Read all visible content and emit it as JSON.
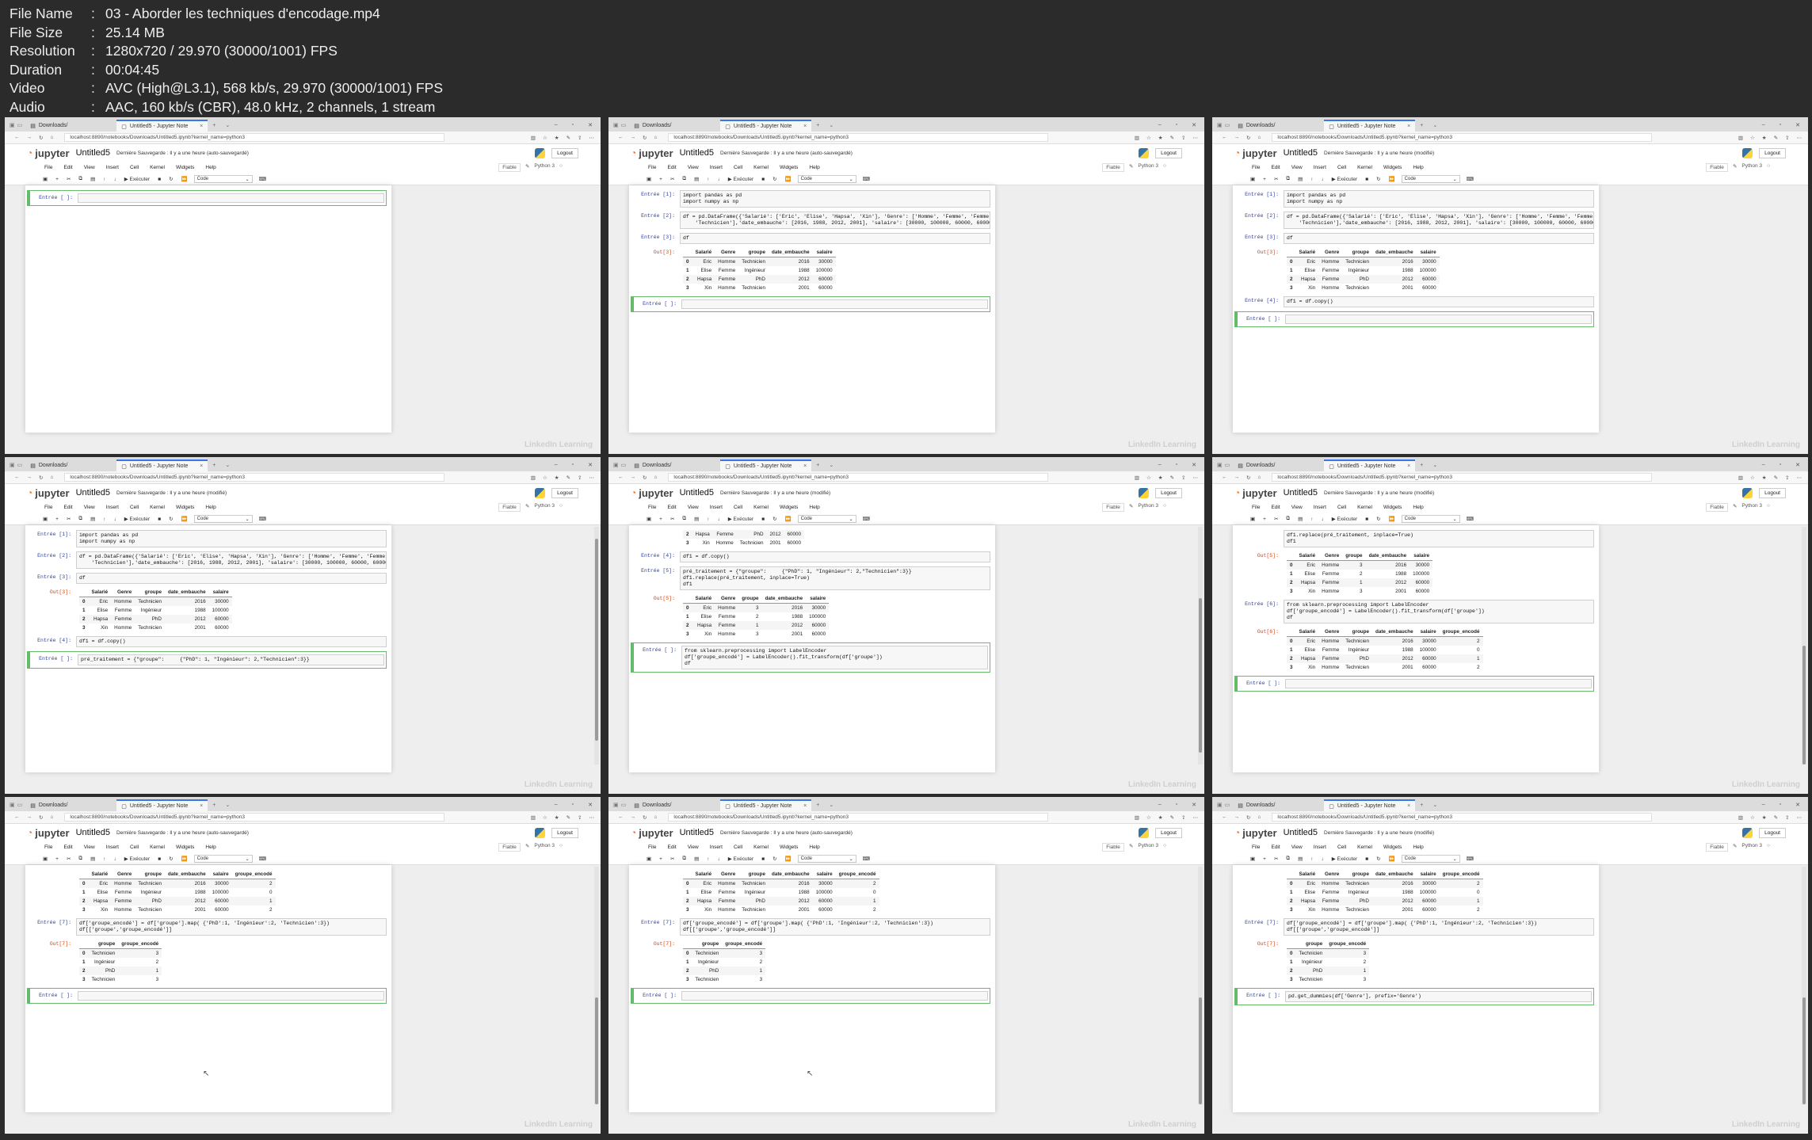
{
  "meta": [
    {
      "key": "File Name",
      "sep": ":",
      "value": "03 - Aborder les techniques d'encodage.mp4"
    },
    {
      "key": "File Size",
      "sep": ":",
      "value": "25.14 MB"
    },
    {
      "key": "Resolution",
      "sep": ":",
      "value": "1280x720 / 29.970 (30000/1001) FPS"
    },
    {
      "key": "Duration",
      "sep": ":",
      "value": "00:04:45"
    },
    {
      "key": "Video",
      "sep": ":",
      "value": "AVC (High@L3.1), 568 kb/s, 29.970 (30000/1001) FPS"
    },
    {
      "key": "Audio",
      "sep": ":",
      "value": "AAC, 160 kb/s (CBR), 48.0 kHz, 2 channels, 1 stream"
    }
  ],
  "browser": {
    "tab_downloads": "Downloads/",
    "tab_jupyter": "Untitled5 - Jupyter Note",
    "tab_close": "×",
    "tab_new": "+",
    "url": "localhost:8890/notebooks/Downloads/Untitled5.ipynb?kernel_name=python3"
  },
  "jupyter": {
    "logo": "jupyter",
    "title": "Untitled5",
    "save_auto": "Dernière Sauvegarde : Il y a une heure  (auto-sauvegardé)",
    "save_mod": "Dernière Sauvegarde : Il y a une heure  (modifié)",
    "logout": "Logout",
    "menus": [
      "File",
      "Edit",
      "View",
      "Insert",
      "Cell",
      "Kernel",
      "Widgets",
      "Help"
    ],
    "trusted": "Fiable",
    "kernel": "Python 3",
    "run": "Exécuter",
    "celltype": "Code"
  },
  "prompts": {
    "in_empty": "Entrée [ ]:",
    "in1": "Entrée [1]:",
    "in2": "Entrée [2]:",
    "in3": "Entrée [3]:",
    "in4": "Entrée [4]:",
    "in5": "Entrée [5]:",
    "in6": "Entrée [6]:",
    "in7": "Entrée [7]:",
    "out3": "Out[3]:",
    "out5": "Out[5]:",
    "out6": "Out[6]:",
    "out7": "Out[7]:"
  },
  "code": {
    "imports": "import pandas as pd\nimport numpy as np",
    "df_create": "df = pd.DataFrame({'Salarié': ['Eric', 'Elise', 'Hapsa', 'Xin'], 'Genre': ['Homme', 'Femme', 'Femme', 'Homme'], 'groupe': ['Tech\n    'Technicien'],'date_embauche': [2016, 1988, 2012, 2001], 'salaire': [30000, 100000, 60000, 60000]})",
    "df": "df",
    "df1_copy": "df1 = df.copy()",
    "pre_partial": "pré_traitement = {\"groupe\":     {\"PhD\": 1, \"Ingénieur\": 2,\"Technicien\":3}}",
    "pre_full": "pré_traitement = {\"groupe\":     {\"PhD\": 1, \"Ingénieur\": 2,\"Technicien\":3}}\ndf1.replace(pré_traitement, inplace=True)\ndf1",
    "pre_tail": "df1.replace(pré_traitement, inplace=True)\ndf1",
    "label_enc": "from sklearn.preprocessing import LabelEncoder\ndf['groupe_encodé'] = LabelEncoder().fit_transform(df['groupe'])\ndf",
    "map_code": "df['groupe_encodé'] = df['groupe'].map( {'PhD':1, 'Ingénieur':2, 'Technicien':3})\ndf[['groupe','groupe_encodé']]",
    "dummies": "pd.get_dummies(df['Genre'], prefix='Genre')"
  },
  "tables": {
    "cols5": [
      "",
      "Salarié",
      "Genre",
      "groupe",
      "date_embauche",
      "salaire"
    ],
    "cols6": [
      "",
      "Salarié",
      "Genre",
      "groupe",
      "date_embauche",
      "salaire",
      "groupe_encodé"
    ],
    "cols2": [
      "",
      "groupe",
      "groupe_encodé"
    ],
    "df": [
      [
        "0",
        "Eric",
        "Homme",
        "Technicien",
        "2016",
        "30000"
      ],
      [
        "1",
        "Elise",
        "Femme",
        "Ingénieur",
        "1988",
        "100000"
      ],
      [
        "2",
        "Hapsa",
        "Femme",
        "PhD",
        "2012",
        "60000"
      ],
      [
        "3",
        "Xin",
        "Homme",
        "Technicien",
        "2001",
        "60000"
      ]
    ],
    "df1": [
      [
        "0",
        "Eric",
        "Homme",
        "3",
        "2016",
        "30000"
      ],
      [
        "1",
        "Elise",
        "Femme",
        "2",
        "1988",
        "100000"
      ],
      [
        "2",
        "Hapsa",
        "Femme",
        "1",
        "2012",
        "60000"
      ],
      [
        "3",
        "Xin",
        "Homme",
        "3",
        "2001",
        "60000"
      ]
    ],
    "df_le": [
      [
        "0",
        "Eric",
        "Homme",
        "Technicien",
        "2016",
        "30000",
        "2"
      ],
      [
        "1",
        "Elise",
        "Femme",
        "Ingénieur",
        "1988",
        "100000",
        "0"
      ],
      [
        "2",
        "Hapsa",
        "Femme",
        "PhD",
        "2012",
        "60000",
        "1"
      ],
      [
        "3",
        "Xin",
        "Homme",
        "Technicien",
        "2001",
        "60000",
        "2"
      ]
    ],
    "map_out": [
      [
        "0",
        "Technicien",
        "3"
      ],
      [
        "1",
        "Ingénieur",
        "2"
      ],
      [
        "2",
        "PhD",
        "1"
      ],
      [
        "3",
        "Technicien",
        "3"
      ]
    ]
  },
  "tiles": [
    {
      "save": "save_auto",
      "scroll": {
        "top": 0.0,
        "size": 0.0
      },
      "cells": [
        {
          "t": "in",
          "p": "in_empty",
          "c": "",
          "edit": true
        }
      ]
    },
    {
      "save": "save_auto",
      "scroll": {
        "top": 0.0,
        "size": 0.0
      },
      "cells": [
        {
          "t": "in",
          "p": "in1",
          "c": "imports"
        },
        {
          "t": "in",
          "p": "in2",
          "c": "df_create"
        },
        {
          "t": "in",
          "p": "in3",
          "c": "df"
        },
        {
          "t": "out",
          "p": "out3",
          "table": "df",
          "cols": "cols5"
        },
        {
          "t": "in",
          "p": "in_empty",
          "c": "",
          "edit": true
        }
      ]
    },
    {
      "save": "save_mod",
      "scroll": {
        "top": 0.0,
        "size": 0.0
      },
      "cells": [
        {
          "t": "in",
          "p": "in1",
          "c": "imports"
        },
        {
          "t": "in",
          "p": "in2",
          "c": "df_create"
        },
        {
          "t": "in",
          "p": "in3",
          "c": "df"
        },
        {
          "t": "out",
          "p": "out3",
          "table": "df",
          "cols": "cols5"
        },
        {
          "t": "in",
          "p": "in4",
          "c": "df1_copy"
        },
        {
          "t": "in",
          "p": "in_empty",
          "c": "",
          "edit": true
        }
      ]
    },
    {
      "save": "save_mod",
      "scroll": {
        "top": 0.05,
        "size": 0.85
      },
      "cells": [
        {
          "t": "in",
          "p": "in1",
          "c": "imports"
        },
        {
          "t": "in",
          "p": "in2",
          "c": "df_create"
        },
        {
          "t": "in",
          "p": "in3",
          "c": "df"
        },
        {
          "t": "out",
          "p": "out3",
          "table": "df",
          "cols": "cols5"
        },
        {
          "t": "in",
          "p": "in4",
          "c": "df1_copy"
        },
        {
          "t": "in",
          "p": "in_empty",
          "c": "pre_partial",
          "edit": true
        }
      ]
    },
    {
      "save": "save_mod",
      "scroll": {
        "top": 0.3,
        "size": 0.65
      },
      "cells": [
        {
          "t": "out",
          "p": "",
          "table": "df_tail",
          "cols": ""
        },
        {
          "t": "in",
          "p": "in4",
          "c": "df1_copy"
        },
        {
          "t": "in",
          "p": "in5",
          "c": "pre_full"
        },
        {
          "t": "out",
          "p": "out5",
          "table": "df1",
          "cols": "cols5"
        },
        {
          "t": "in",
          "p": "in_empty",
          "c": "label_enc",
          "edit": true
        }
      ]
    },
    {
      "save": "save_mod",
      "scroll": {
        "top": 0.5,
        "size": 0.5
      },
      "cells": [
        {
          "t": "in",
          "p": "",
          "c": "pre_tail"
        },
        {
          "t": "out",
          "p": "out5",
          "table": "df1",
          "cols": "cols5"
        },
        {
          "t": "in",
          "p": "in6",
          "c": "label_enc"
        },
        {
          "t": "out",
          "p": "out6",
          "table": "df_le",
          "cols": "cols6"
        },
        {
          "t": "in",
          "p": "in_empty",
          "c": "",
          "edit": true
        }
      ]
    },
    {
      "save": "save_auto",
      "scroll": {
        "top": 0.55,
        "size": 0.45
      },
      "cells": [
        {
          "t": "out",
          "p": "",
          "table": "df_le",
          "cols": "cols6"
        },
        {
          "t": "in",
          "p": "in7",
          "c": "map_code"
        },
        {
          "t": "out",
          "p": "out7",
          "table": "map_out",
          "cols": "cols2"
        },
        {
          "t": "in",
          "p": "in_empty",
          "c": "",
          "edit": true
        }
      ]
    },
    {
      "save": "save_auto",
      "scroll": {
        "top": 0.55,
        "size": 0.45
      },
      "cells": [
        {
          "t": "out",
          "p": "",
          "table": "df_le",
          "cols": "cols6"
        },
        {
          "t": "in",
          "p": "in7",
          "c": "map_code"
        },
        {
          "t": "out",
          "p": "out7",
          "table": "map_out",
          "cols": "cols2"
        },
        {
          "t": "in",
          "p": "in_empty",
          "c": "",
          "edit": true
        }
      ]
    },
    {
      "save": "save_mod",
      "scroll": {
        "top": 0.55,
        "size": 0.45
      },
      "cells": [
        {
          "t": "out",
          "p": "",
          "table": "df_le",
          "cols": "cols6"
        },
        {
          "t": "in",
          "p": "in7",
          "c": "map_code"
        },
        {
          "t": "out",
          "p": "out7",
          "table": "map_out",
          "cols": "cols2"
        },
        {
          "t": "in",
          "p": "in_empty",
          "c": "dummies",
          "edit": true
        }
      ]
    }
  ],
  "watermark": "LinkedIn Learning",
  "icons": {
    "back": "arrow-left-icon",
    "forward": "arrow-right-icon",
    "reload": "reload-icon",
    "home": "home-icon"
  }
}
